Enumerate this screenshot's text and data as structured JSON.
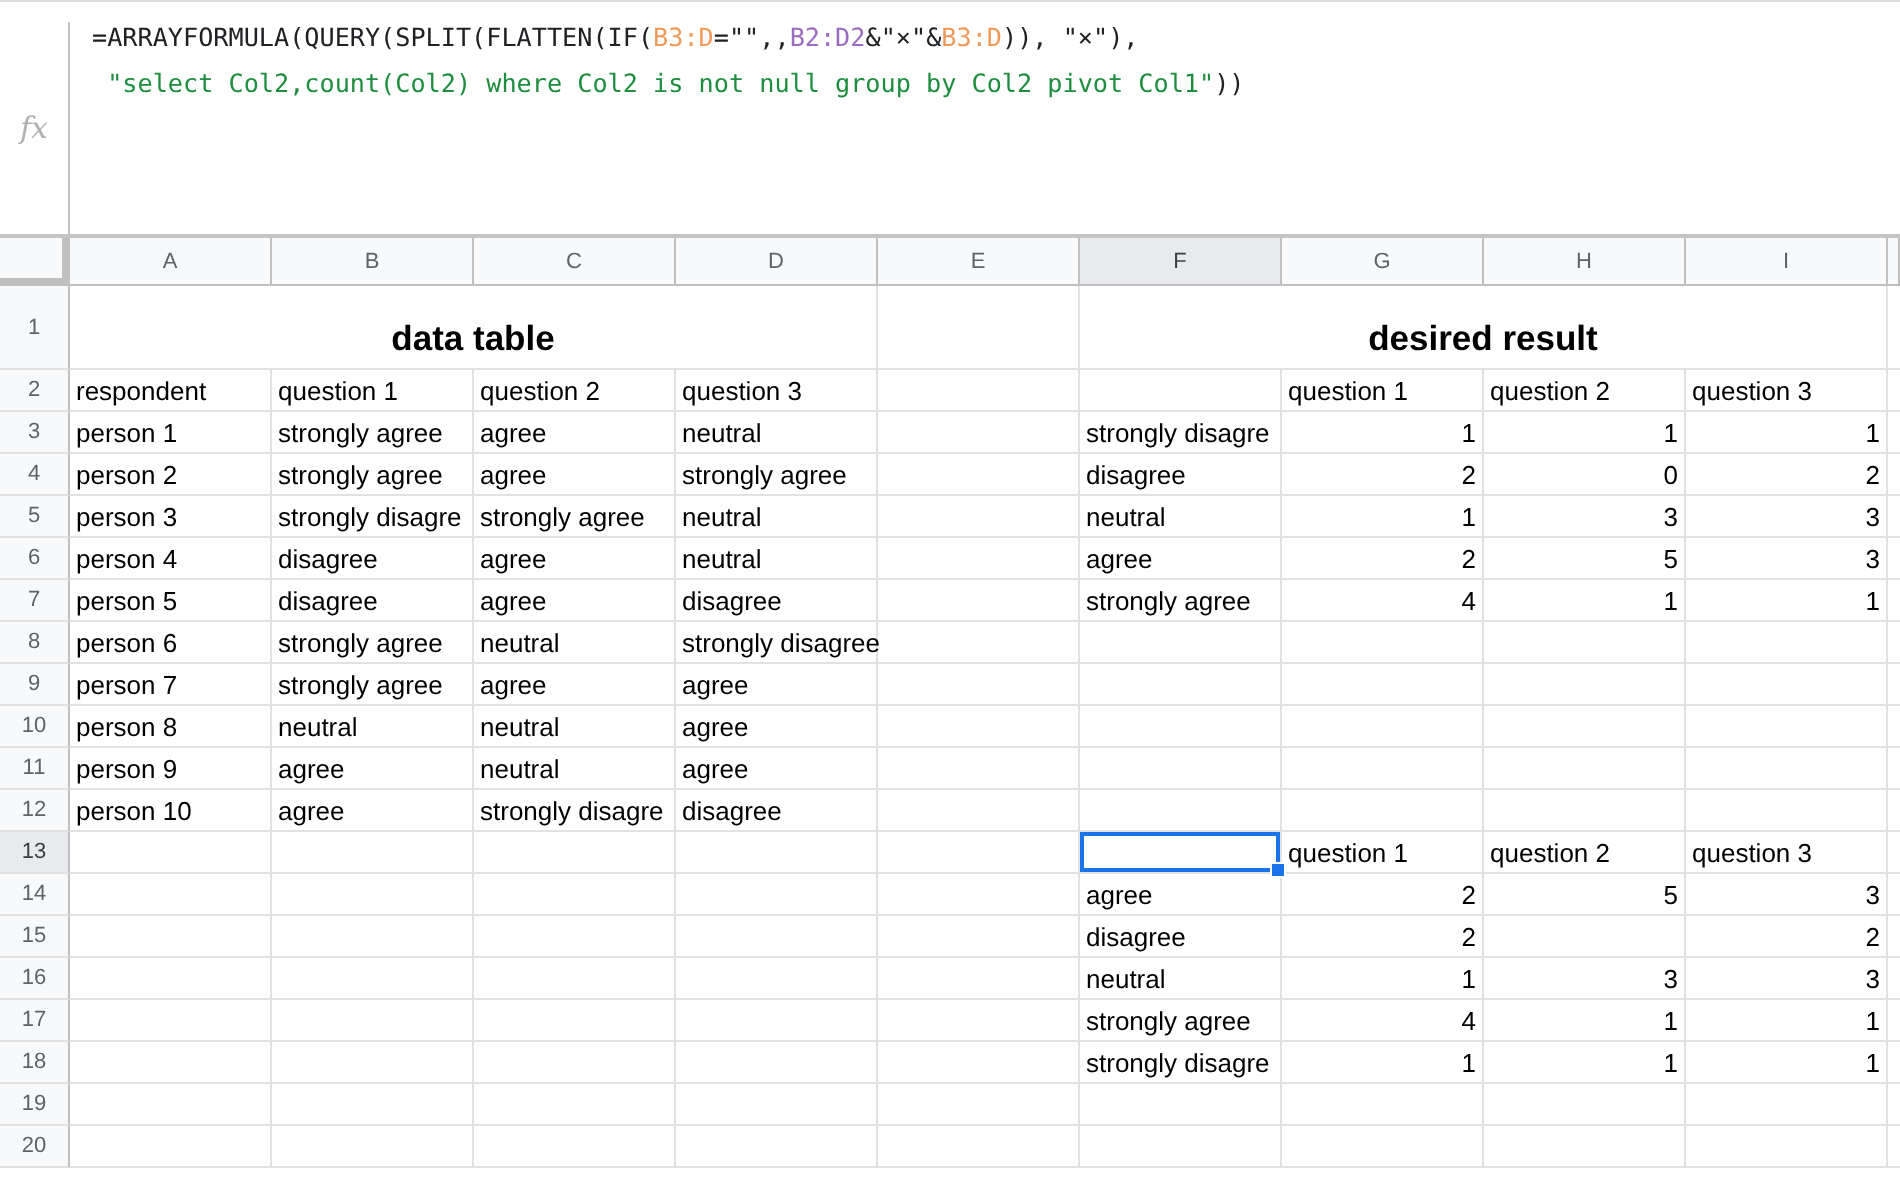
{
  "formula_bar": {
    "icon_text": "fx",
    "lines": [
      [
        {
          "text": "=ARRAYFORMULA(QUERY(SPLIT(FLATTEN(IF(",
          "color": "#202124"
        },
        {
          "text": "B3:D",
          "color": "#f09a5a"
        },
        {
          "text": "=\"\",,",
          "color": "#202124"
        },
        {
          "text": "B2:D2",
          "color": "#9b6cbf"
        },
        {
          "text": "&\"×\"&",
          "color": "#202124"
        },
        {
          "text": "B3:D",
          "color": "#f09a5a"
        },
        {
          "text": ")), \"×\"),",
          "color": "#202124"
        }
      ],
      [
        {
          "text": " \"select Col2,count(Col2) where Col2 is not null group by Col2 pivot Col1\"",
          "color": "#1e8e3e"
        },
        {
          "text": "))",
          "color": "#202124"
        }
      ]
    ]
  },
  "columns": [
    {
      "label": "A",
      "selected": false
    },
    {
      "label": "B",
      "selected": false
    },
    {
      "label": "C",
      "selected": false
    },
    {
      "label": "D",
      "selected": false
    },
    {
      "label": "E",
      "selected": false
    },
    {
      "label": "F",
      "selected": true
    },
    {
      "label": "G",
      "selected": false
    },
    {
      "label": "H",
      "selected": false
    },
    {
      "label": "I",
      "selected": false
    }
  ],
  "rows": [
    {
      "label": "1",
      "selected": false,
      "cells": [
        {
          "text": "data table",
          "kind": "title"
        },
        null,
        null,
        null,
        null,
        {
          "text": "desired result",
          "kind": "title"
        },
        null,
        null,
        null
      ]
    },
    {
      "label": "2",
      "selected": false,
      "cells": [
        {
          "text": "respondent",
          "kind": "text"
        },
        {
          "text": "question 1",
          "kind": "text"
        },
        {
          "text": "question 2",
          "kind": "text"
        },
        {
          "text": "question 3",
          "kind": "text"
        },
        null,
        null,
        {
          "text": "question 1",
          "kind": "text"
        },
        {
          "text": "question 2",
          "kind": "text"
        },
        {
          "text": "question 3",
          "kind": "text"
        }
      ]
    },
    {
      "label": "3",
      "selected": false,
      "cells": [
        {
          "text": "person 1",
          "kind": "text"
        },
        {
          "text": "strongly agree",
          "kind": "text"
        },
        {
          "text": "agree",
          "kind": "text"
        },
        {
          "text": "neutral",
          "kind": "text"
        },
        null,
        {
          "text": "strongly disagre",
          "kind": "text"
        },
        {
          "text": "1",
          "kind": "number"
        },
        {
          "text": "1",
          "kind": "number"
        },
        {
          "text": "1",
          "kind": "number"
        }
      ]
    },
    {
      "label": "4",
      "selected": false,
      "cells": [
        {
          "text": "person 2",
          "kind": "text"
        },
        {
          "text": "strongly agree",
          "kind": "text"
        },
        {
          "text": "agree",
          "kind": "text"
        },
        {
          "text": "strongly agree",
          "kind": "text"
        },
        null,
        {
          "text": "disagree",
          "kind": "text"
        },
        {
          "text": "2",
          "kind": "number"
        },
        {
          "text": "0",
          "kind": "number"
        },
        {
          "text": "2",
          "kind": "number"
        }
      ]
    },
    {
      "label": "5",
      "selected": false,
      "cells": [
        {
          "text": "person 3",
          "kind": "text"
        },
        {
          "text": "strongly disagre",
          "kind": "text"
        },
        {
          "text": "strongly agree",
          "kind": "text"
        },
        {
          "text": "neutral",
          "kind": "text"
        },
        null,
        {
          "text": "neutral",
          "kind": "text"
        },
        {
          "text": "1",
          "kind": "number"
        },
        {
          "text": "3",
          "kind": "number"
        },
        {
          "text": "3",
          "kind": "number"
        }
      ]
    },
    {
      "label": "6",
      "selected": false,
      "cells": [
        {
          "text": "person 4",
          "kind": "text"
        },
        {
          "text": "disagree",
          "kind": "text"
        },
        {
          "text": "agree",
          "kind": "text"
        },
        {
          "text": "neutral",
          "kind": "text"
        },
        null,
        {
          "text": "agree",
          "kind": "text"
        },
        {
          "text": "2",
          "kind": "number"
        },
        {
          "text": "5",
          "kind": "number"
        },
        {
          "text": "3",
          "kind": "number"
        }
      ]
    },
    {
      "label": "7",
      "selected": false,
      "cells": [
        {
          "text": "person 5",
          "kind": "text"
        },
        {
          "text": "disagree",
          "kind": "text"
        },
        {
          "text": "agree",
          "kind": "text"
        },
        {
          "text": "disagree",
          "kind": "text"
        },
        null,
        {
          "text": "strongly agree",
          "kind": "text"
        },
        {
          "text": "4",
          "kind": "number"
        },
        {
          "text": "1",
          "kind": "number"
        },
        {
          "text": "1",
          "kind": "number"
        }
      ]
    },
    {
      "label": "8",
      "selected": false,
      "cells": [
        {
          "text": "person 6",
          "kind": "text"
        },
        {
          "text": "strongly agree",
          "kind": "text"
        },
        {
          "text": "neutral",
          "kind": "text"
        },
        {
          "text": "strongly disagree",
          "kind": "text"
        },
        null,
        null,
        null,
        null,
        null
      ]
    },
    {
      "label": "9",
      "selected": false,
      "cells": [
        {
          "text": "person 7",
          "kind": "text"
        },
        {
          "text": "strongly agree",
          "kind": "text"
        },
        {
          "text": "agree",
          "kind": "text"
        },
        {
          "text": "agree",
          "kind": "text"
        },
        null,
        null,
        null,
        null,
        null
      ]
    },
    {
      "label": "10",
      "selected": false,
      "cells": [
        {
          "text": "person 8",
          "kind": "text"
        },
        {
          "text": "neutral",
          "kind": "text"
        },
        {
          "text": "neutral",
          "kind": "text"
        },
        {
          "text": "agree",
          "kind": "text"
        },
        null,
        null,
        null,
        null,
        null
      ]
    },
    {
      "label": "11",
      "selected": false,
      "cells": [
        {
          "text": "person 9",
          "kind": "text"
        },
        {
          "text": "agree",
          "kind": "text"
        },
        {
          "text": "neutral",
          "kind": "text"
        },
        {
          "text": "agree",
          "kind": "text"
        },
        null,
        null,
        null,
        null,
        null
      ]
    },
    {
      "label": "12",
      "selected": false,
      "cells": [
        {
          "text": "person 10",
          "kind": "text"
        },
        {
          "text": "agree",
          "kind": "text"
        },
        {
          "text": "strongly disagre",
          "kind": "text"
        },
        {
          "text": "disagree",
          "kind": "text"
        },
        null,
        null,
        null,
        null,
        null
      ]
    },
    {
      "label": "13",
      "selected": true,
      "cells": [
        null,
        null,
        null,
        null,
        null,
        null,
        {
          "text": "question 1",
          "kind": "text"
        },
        {
          "text": "question 2",
          "kind": "text"
        },
        {
          "text": "question 3",
          "kind": "text"
        }
      ]
    },
    {
      "label": "14",
      "selected": false,
      "cells": [
        null,
        null,
        null,
        null,
        null,
        {
          "text": "agree",
          "kind": "text"
        },
        {
          "text": "2",
          "kind": "number"
        },
        {
          "text": "5",
          "kind": "number"
        },
        {
          "text": "3",
          "kind": "number"
        }
      ]
    },
    {
      "label": "15",
      "selected": false,
      "cells": [
        null,
        null,
        null,
        null,
        null,
        {
          "text": "disagree",
          "kind": "text"
        },
        {
          "text": "2",
          "kind": "number"
        },
        null,
        {
          "text": "2",
          "kind": "number"
        }
      ]
    },
    {
      "label": "16",
      "selected": false,
      "cells": [
        null,
        null,
        null,
        null,
        null,
        {
          "text": "neutral",
          "kind": "text"
        },
        {
          "text": "1",
          "kind": "number"
        },
        {
          "text": "3",
          "kind": "number"
        },
        {
          "text": "3",
          "kind": "number"
        }
      ]
    },
    {
      "label": "17",
      "selected": false,
      "cells": [
        null,
        null,
        null,
        null,
        null,
        {
          "text": "strongly agree",
          "kind": "text"
        },
        {
          "text": "4",
          "kind": "number"
        },
        {
          "text": "1",
          "kind": "number"
        },
        {
          "text": "1",
          "kind": "number"
        }
      ]
    },
    {
      "label": "18",
      "selected": false,
      "cells": [
        null,
        null,
        null,
        null,
        null,
        {
          "text": "strongly disagre",
          "kind": "text"
        },
        {
          "text": "1",
          "kind": "number"
        },
        {
          "text": "1",
          "kind": "number"
        },
        {
          "text": "1",
          "kind": "number"
        }
      ]
    },
    {
      "label": "19",
      "selected": false,
      "cells": [
        null,
        null,
        null,
        null,
        null,
        null,
        null,
        null,
        null
      ]
    },
    {
      "label": "20",
      "selected": false,
      "cells": [
        null,
        null,
        null,
        null,
        null,
        null,
        null,
        null,
        null
      ]
    }
  ]
}
